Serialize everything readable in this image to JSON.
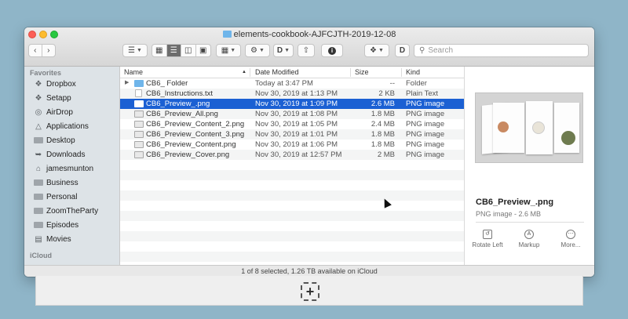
{
  "window": {
    "title": "elements-cookbook-AJFCJTH-2019-12-08"
  },
  "toolbar": {
    "back_icon": "chevron-left-icon",
    "forward_icon": "chevron-right-icon",
    "search_placeholder": "Search"
  },
  "sidebar": {
    "favorites_header": "Favorites",
    "icloud_header": "iCloud",
    "items": [
      {
        "label": "Dropbox",
        "icon": "dropbox-icon"
      },
      {
        "label": "Setapp",
        "icon": "setapp-icon"
      },
      {
        "label": "AirDrop",
        "icon": "airdrop-icon"
      },
      {
        "label": "Applications",
        "icon": "applications-icon"
      },
      {
        "label": "Desktop",
        "icon": "desktop-icon"
      },
      {
        "label": "Downloads",
        "icon": "downloads-icon"
      },
      {
        "label": "jamesmunton",
        "icon": "home-icon"
      },
      {
        "label": "Business",
        "icon": "folder-icon"
      },
      {
        "label": "Personal",
        "icon": "folder-icon"
      },
      {
        "label": "ZoomTheParty",
        "icon": "folder-icon"
      },
      {
        "label": "Episodes",
        "icon": "folder-icon"
      },
      {
        "label": "Movies",
        "icon": "movies-icon"
      }
    ]
  },
  "columns": {
    "name": "Name",
    "date": "Date Modified",
    "size": "Size",
    "kind": "Kind"
  },
  "files": [
    {
      "name": "CB6_ Folder",
      "date": "Today at 3:47 PM",
      "size": "--",
      "kind": "Folder",
      "type": "folder",
      "selected": false
    },
    {
      "name": "CB6_Instructions.txt",
      "date": "Nov 30, 2019 at 1:13 PM",
      "size": "2 KB",
      "kind": "Plain Text",
      "type": "txt",
      "selected": false
    },
    {
      "name": "CB6_Preview_.png",
      "date": "Nov 30, 2019 at 1:09 PM",
      "size": "2.6 MB",
      "kind": "PNG image",
      "type": "png",
      "selected": true
    },
    {
      "name": "CB6_Preview_All.png",
      "date": "Nov 30, 2019 at 1:08 PM",
      "size": "1.8 MB",
      "kind": "PNG image",
      "type": "png",
      "selected": false
    },
    {
      "name": "CB6_Preview_Content_2.png",
      "date": "Nov 30, 2019 at 1:05 PM",
      "size": "2.4 MB",
      "kind": "PNG image",
      "type": "png",
      "selected": false
    },
    {
      "name": "CB6_Preview_Content_3.png",
      "date": "Nov 30, 2019 at 1:01 PM",
      "size": "1.8 MB",
      "kind": "PNG image",
      "type": "png",
      "selected": false
    },
    {
      "name": "CB6_Preview_Content.png",
      "date": "Nov 30, 2019 at 1:06 PM",
      "size": "1.8 MB",
      "kind": "PNG image",
      "type": "png",
      "selected": false
    },
    {
      "name": "CB6_Preview_Cover.png",
      "date": "Nov 30, 2019 at 12:57 PM",
      "size": "2 MB",
      "kind": "PNG image",
      "type": "png",
      "selected": false
    }
  ],
  "preview": {
    "name": "CB6_Preview_.png",
    "meta": "PNG image - 2.6 MB",
    "actions": [
      {
        "label": "Rotate Left",
        "icon": "rotate-left-icon"
      },
      {
        "label": "Markup",
        "icon": "markup-icon"
      },
      {
        "label": "More...",
        "icon": "more-icon"
      }
    ]
  },
  "status": {
    "text": "1 of 8 selected, 1.26 TB available on iCloud"
  },
  "colors": {
    "selection": "#1b60d3",
    "folder": "#6fb5ea",
    "sidebar_bg": "#dde3e7",
    "desktop_bg": "#8fb5c8"
  }
}
